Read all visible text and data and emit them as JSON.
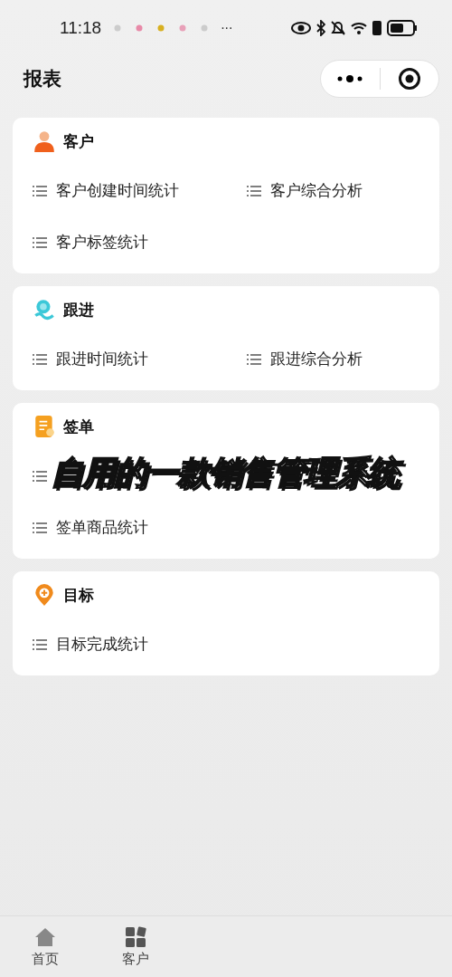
{
  "status_bar": {
    "time": "11:18",
    "more": "···"
  },
  "header": {
    "title": "报表"
  },
  "sections": [
    {
      "title": "客户",
      "items": [
        {
          "label": "客户创建时间统计"
        },
        {
          "label": "客户综合分析"
        },
        {
          "label": "客户标签统计"
        }
      ]
    },
    {
      "title": "跟进",
      "items": [
        {
          "label": "跟进时间统计"
        },
        {
          "label": "跟进综合分析"
        }
      ]
    },
    {
      "title": "签单",
      "items": [
        {
          "kind": "covered"
        },
        {
          "label": "签单商品统计"
        }
      ]
    },
    {
      "title": "目标",
      "items": [
        {
          "label": "目标完成统计"
        }
      ]
    }
  ],
  "caption": "自用的一款销售管理系统",
  "tab_bar": [
    {
      "label": "首页"
    },
    {
      "label": "客户"
    }
  ]
}
